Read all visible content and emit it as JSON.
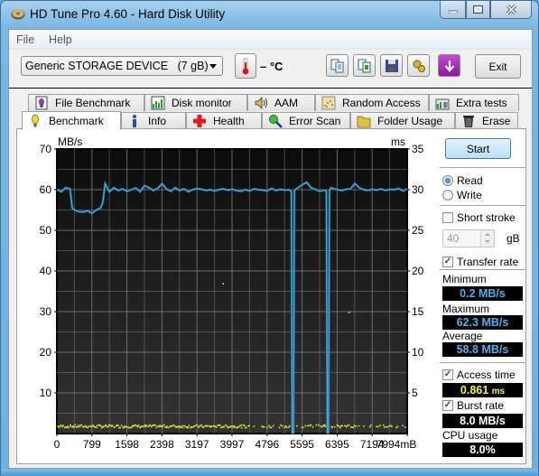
{
  "window": {
    "title": "HD Tune Pro 4.60 - Hard Disk Utility",
    "controls": {
      "minimize": "minimize",
      "maximize": "maximize",
      "close": "close"
    }
  },
  "menu": {
    "items": [
      {
        "label": "File"
      },
      {
        "label": "Help"
      }
    ]
  },
  "toolbar": {
    "drive": "Generic STORAGE DEVICE   (7 gB)",
    "temperature": "– °C",
    "buttons": [
      {
        "name": "copy-text-icon"
      },
      {
        "name": "copy-screenshot-icon"
      },
      {
        "name": "save-icon"
      },
      {
        "name": "options-icon"
      },
      {
        "name": "download-icon"
      }
    ],
    "exit_label": "Exit"
  },
  "tabs": {
    "row1": [
      {
        "label": "File Benchmark",
        "icon": "file-benchmark-icon"
      },
      {
        "label": "Disk monitor",
        "icon": "disk-monitor-icon"
      },
      {
        "label": "AAM",
        "icon": "speaker-icon"
      },
      {
        "label": "Random Access",
        "icon": "random-access-icon"
      },
      {
        "label": "Extra tests",
        "icon": "extra-tests-icon"
      }
    ],
    "row2": [
      {
        "label": "Benchmark",
        "icon": "lightbulb-icon",
        "active": true
      },
      {
        "label": "Info",
        "icon": "info-icon"
      },
      {
        "label": "Health",
        "icon": "health-cross-icon"
      },
      {
        "label": "Error Scan",
        "icon": "magnifier-icon"
      },
      {
        "label": "Folder Usage",
        "icon": "folder-icon"
      },
      {
        "label": "Erase",
        "icon": "trash-icon"
      }
    ]
  },
  "side": {
    "start_label": "Start",
    "read_label": "Read",
    "write_label": "Write",
    "mode": "read",
    "short_stroke_label": "Short stroke",
    "short_stroke_checked": false,
    "short_stroke_value": "40",
    "short_stroke_unit": "gB",
    "transfer_rate_label": "Transfer rate",
    "transfer_rate_checked": true,
    "minimum_label": "Minimum",
    "minimum_value": "0.2 MB/s",
    "maximum_label": "Maximum",
    "maximum_value": "62.3 MB/s",
    "average_label": "Average",
    "average_value": "58.8 MB/s",
    "access_time_label": "Access time",
    "access_time_checked": true,
    "access_time_value": "0.861",
    "access_time_unit": "ms",
    "burst_rate_label": "Burst rate",
    "burst_rate_checked": true,
    "burst_rate_value": "8.0 MB/s",
    "cpu_label": "CPU usage",
    "cpu_value": "8.0%"
  },
  "colors": {
    "transfer_line": "#4fb0e0",
    "access_points": "#e8e83a",
    "plot_bg_top": "#0c0c0c",
    "plot_bg_bottom": "#333333",
    "grid": "#7a7a7a"
  },
  "chart_data": {
    "type": "line",
    "title": "",
    "ylabel": "MB/s",
    "y2label": "ms",
    "xlabel": "mB",
    "ylim": [
      0,
      70
    ],
    "y2lim": [
      0,
      35
    ],
    "xlim": [
      0,
      7994
    ],
    "y_ticks": [
      10,
      20,
      30,
      40,
      50,
      60,
      70
    ],
    "y2_ticks": [
      5,
      10,
      15,
      20,
      25,
      30,
      35
    ],
    "x_ticks": [
      "0",
      "799",
      "1598",
      "2398",
      "3197",
      "3997",
      "4796",
      "5595",
      "6395",
      "7194",
      "7994mB"
    ],
    "grid": true,
    "series": [
      {
        "name": "Transfer rate (MB/s)",
        "x": [
          0,
          100,
          200,
          300,
          350,
          400,
          500,
          600,
          700,
          800,
          900,
          1000,
          1050,
          1100,
          1200,
          1300,
          1400,
          1500,
          1600,
          1700,
          1800,
          1900,
          2000,
          2100,
          2200,
          2300,
          2400,
          2500,
          2600,
          2700,
          2800,
          2900,
          3000,
          3100,
          3200,
          3300,
          3400,
          3500,
          3600,
          3700,
          3800,
          3900,
          4000,
          4100,
          4200,
          4300,
          4400,
          4500,
          4600,
          4700,
          4800,
          4900,
          5000,
          5100,
          5200,
          5300,
          5350,
          5370,
          5400,
          5420,
          5450,
          5500,
          5600,
          5700,
          5800,
          5900,
          6000,
          6100,
          6150,
          6170,
          6200,
          6220,
          6250,
          6300,
          6400,
          6500,
          6600,
          6700,
          6800,
          6900,
          7000,
          7100,
          7200,
          7300,
          7400,
          7500,
          7600,
          7700,
          7800,
          7900,
          7994
        ],
        "values": [
          60,
          59.5,
          60.5,
          60.2,
          55.5,
          55,
          54.6,
          54.5,
          54.8,
          54.2,
          55,
          55.5,
          57,
          61.5,
          59.5,
          60.5,
          59.8,
          60.2,
          59.6,
          60,
          60.4,
          59.5,
          61,
          60.5,
          59.8,
          60.3,
          61.5,
          60.2,
          59.6,
          60.5,
          59.8,
          60.2,
          59.5,
          60,
          60.3,
          60.1,
          59.8,
          60,
          59.7,
          60,
          60.2,
          59.9,
          60.1,
          59.8,
          59.6,
          60,
          59.7,
          60.2,
          60,
          59.9,
          59.7,
          60.3,
          59.8,
          60.1,
          59.9,
          60,
          59.6,
          0.2,
          0.2,
          59.6,
          60.1,
          60.5,
          61.2,
          61.8,
          60.5,
          60.1,
          59.6,
          59.9,
          59.7,
          0.2,
          0.2,
          59.8,
          60.5,
          60.3,
          60,
          59.8,
          60.1,
          60.2,
          61.5,
          60.5,
          60,
          59.8,
          60.1,
          59.9,
          60.2,
          59.8,
          60.1,
          60,
          60.3,
          59.7,
          60.2
        ]
      },
      {
        "name": "Access time (ms)",
        "type": "scatter",
        "axis": "right",
        "x_range": [
          0,
          7994
        ],
        "typical_value_ms": 0.86,
        "outliers": [
          {
            "x": 3780,
            "y_ms": 18.5
          },
          {
            "x": 6650,
            "y_ms": 15
          }
        ]
      }
    ]
  }
}
